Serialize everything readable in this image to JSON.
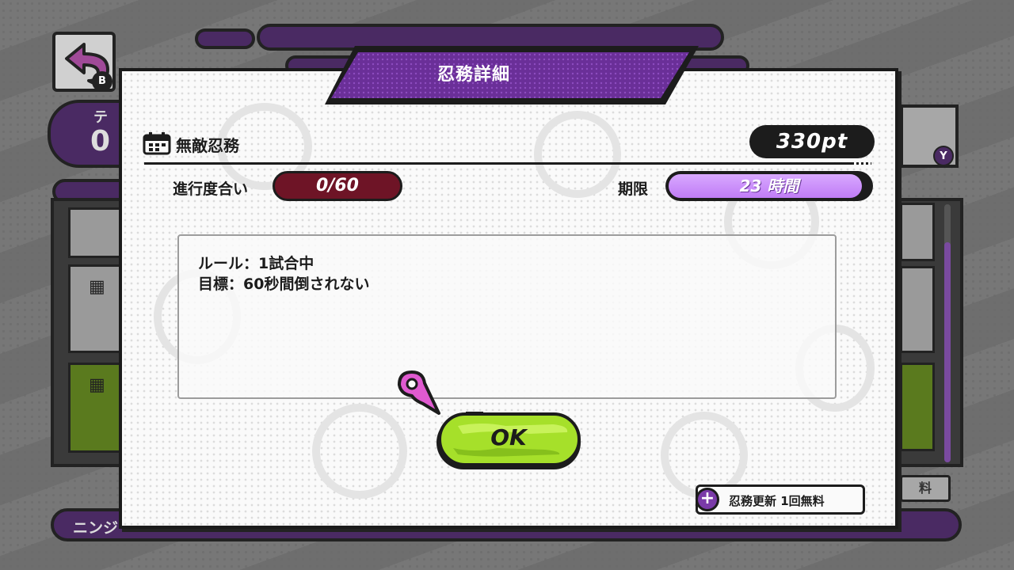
{
  "background": {
    "left_tab_label": "テ",
    "left_tab_value": "0",
    "right_small_label": "料",
    "bottom_bar_text": "ニンジ"
  },
  "dialog": {
    "title": "忍務詳細",
    "mission_name": "無敵忍務",
    "points": "330pt",
    "progress_label": "進行度合い",
    "progress_value": "0/60",
    "deadline_label": "期限",
    "deadline_value": "23 時間",
    "deadline_fraction": 0.96,
    "description": {
      "line1": "ルール：1試合中",
      "line2": "目標：60秒間倒されない"
    },
    "ok_label": "OK",
    "refresh_label": "忍務更新 1回無料"
  },
  "colors": {
    "title_purple": "#7a3aa8",
    "ok_green": "#a6e02a",
    "progress_maroon": "#6e1426",
    "deadline_lavender": "#c07cf6",
    "cursor_pink": "#e05ad0"
  },
  "icons": [
    "calendar-icon",
    "back-arrow-icon",
    "plus-icon",
    "pointer-cursor-icon"
  ]
}
